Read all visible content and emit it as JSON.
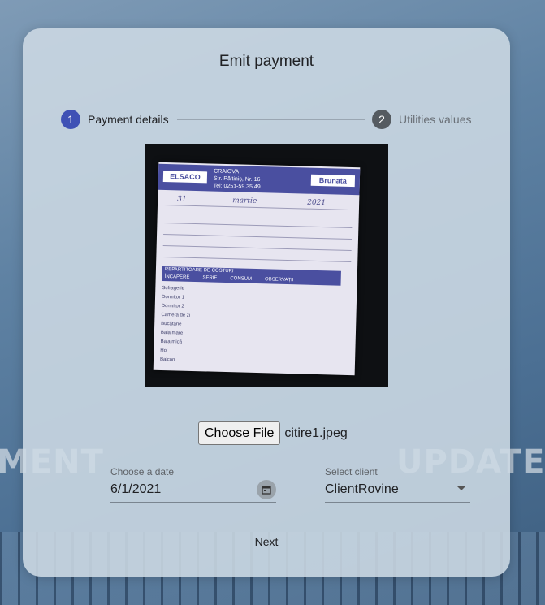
{
  "background": {
    "words": [
      "MENT",
      "UPDATE"
    ]
  },
  "dialog": {
    "title": "Emit payment",
    "steps": [
      {
        "number": "1",
        "label": "Payment details",
        "state": "active",
        "color": "#3f51b5"
      },
      {
        "number": "2",
        "label": "Utilities values",
        "state": "inactive",
        "color": "#555b61"
      }
    ],
    "receipt": {
      "company": "ELSACO",
      "city": "CRAIOVA",
      "address": "Str. Păltiniș, Nr. 16",
      "phone": "Tel: 0251-59.35.49",
      "brand": "Brunata",
      "table_title": "REPARTITOARE DE COSTURI",
      "columns": [
        "ÎNCĂPERE",
        "SERIE",
        "CONSUM",
        "OBSERVAȚII"
      ],
      "rooms": [
        "Sufragerie",
        "Dormitor 1",
        "Dormitor 2",
        "Camera de zi",
        "Bucătărie",
        "Baia mare",
        "Baia mică",
        "Hol",
        "Balcon"
      ],
      "handwriting": {
        "day": "31",
        "month": "martie",
        "year": "2021"
      }
    },
    "file": {
      "button_label": "Choose File",
      "file_name": "citire1.jpeg"
    },
    "date_field": {
      "label": "Choose a date",
      "value": "6/1/2021"
    },
    "client_field": {
      "label": "Select client",
      "value": "ClientRovine"
    },
    "next_label": "Next"
  },
  "colors": {
    "accent": "#3f51b5",
    "card": "#cddae4"
  }
}
